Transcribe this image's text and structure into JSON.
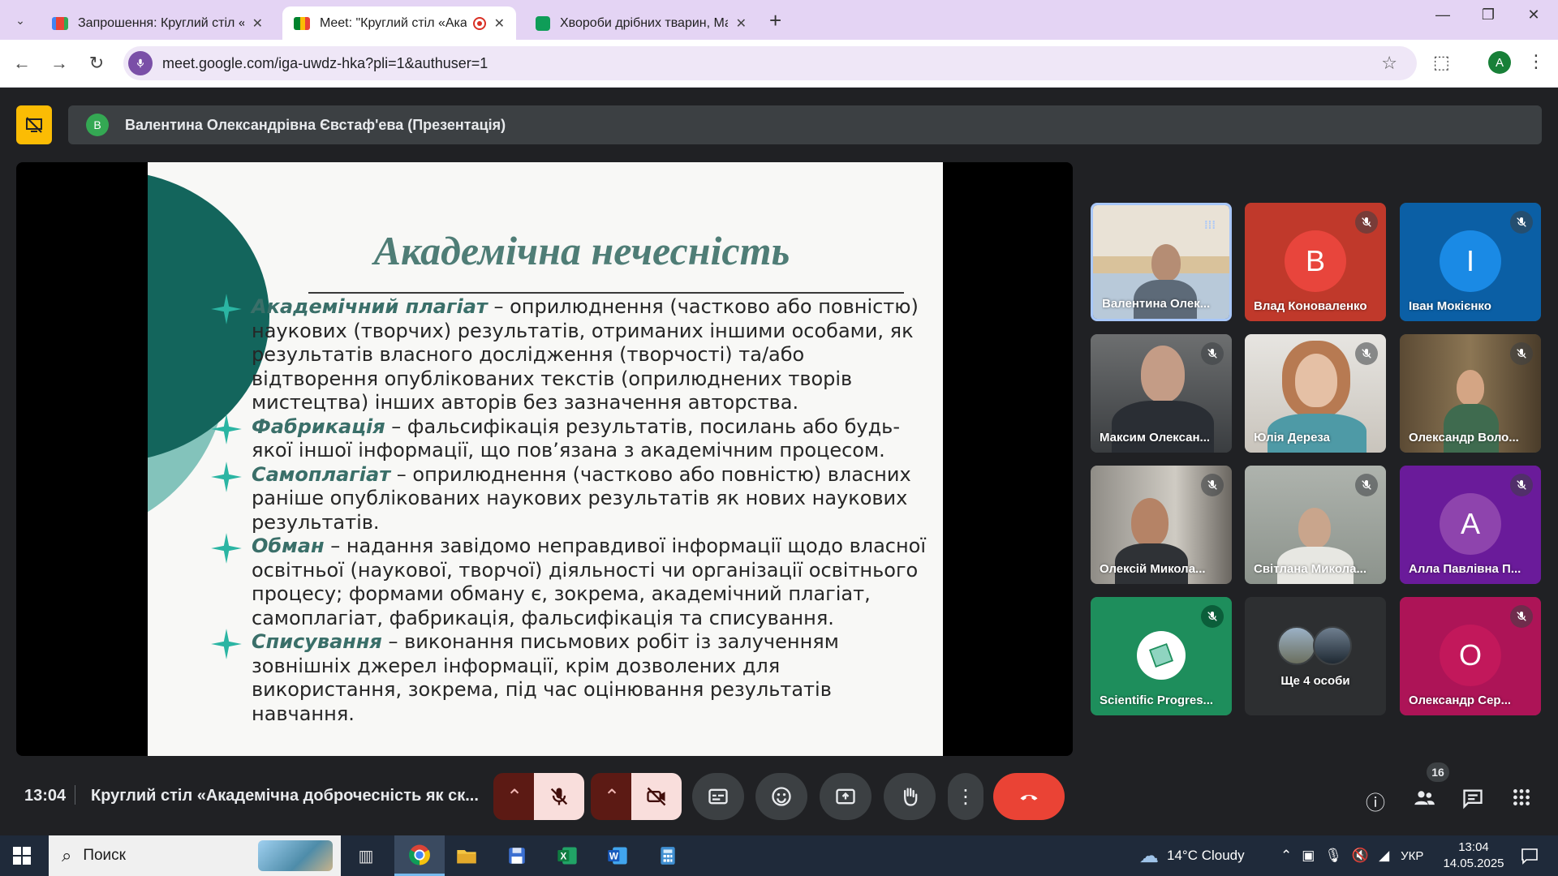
{
  "browser": {
    "tabs": [
      {
        "title": "Запрошення: Круглий стіл «Академічна доброчесність",
        "favicon": "gmail-icon",
        "active": false
      },
      {
        "title": "Meet: \"Круглий стіл «Академічна доброчесність",
        "favicon": "meet-icon",
        "active": true
      },
      {
        "title": "Хвороби дрібних тварин, Магістри",
        "favicon": "sheets-icon",
        "active": false
      }
    ],
    "url": "meet.google.com/iga-uwdz-hka?pli=1&authuser=1",
    "profile_initial": "A"
  },
  "presenter": {
    "initial": "В",
    "label": "Валентина Олександрівна Євстаф'ева (Презентація)"
  },
  "slide": {
    "title": "Академічна нечесність",
    "bullets": [
      {
        "term": "Академічний плагіат",
        "text": " – оприлюднення (частково або повністю) наукових (творчих) результатів, отриманих іншими особами, як результатів власного дослідження (творчості) та/або відтворення опублікованих текстів (оприлюднених творів мистецтва) інших авторів без зазначення авторства."
      },
      {
        "term": "Фабрикація",
        "text": " – фальсифікація результатів, посилань або будь-якої іншої інформації, що пов’язана з академічним процесом."
      },
      {
        "term": "Самоплагіат",
        "text": " – оприлюднення (частково або повністю) власних раніше опублікованих наукових результатів як нових наукових результатів."
      },
      {
        "term": "Обман",
        "text": " – надання завідомо неправдивої інформації щодо власної освітньої (наукової, творчої) діяльності чи організації освітнього процесу; формами обману є, зокрема, академічний плагіат, самоплагіат, фабрикація, фальсифікація та списування."
      },
      {
        "term": "Списування",
        "text": " – виконання письмових робіт із залученням зовнішніх джерел інформації, крім дозволених для використання, зокрема, під час оцінювання результатів навчання."
      }
    ]
  },
  "participants": [
    {
      "name": "Валентина Олек...",
      "type": "video",
      "speaking": true
    },
    {
      "name": "Влад Коноваленко",
      "type": "avatar",
      "initial": "В",
      "color": "#e8453c"
    },
    {
      "name": "Іван Мокієнко",
      "type": "avatar",
      "initial": "І",
      "color": "#1a8ae5"
    },
    {
      "name": "Максим Олексан...",
      "type": "video"
    },
    {
      "name": "Юлія Дереза",
      "type": "video"
    },
    {
      "name": "Олександр Воло...",
      "type": "video"
    },
    {
      "name": "Олексій Микола...",
      "type": "video"
    },
    {
      "name": "Світлана Микола...",
      "type": "video"
    },
    {
      "name": "Алла Павлівна П...",
      "type": "avatar",
      "initial": "А",
      "color": "#8e44ad"
    },
    {
      "name": "Scientific Progres...",
      "type": "logo"
    },
    {
      "name": "Ще 4 особи",
      "type": "more"
    },
    {
      "name": "Олександр Сер...",
      "type": "avatar",
      "initial": "О",
      "color": "#c2185b"
    }
  ],
  "controls": {
    "time": "13:04",
    "meeting_title": "Круглий стіл «Академічна доброчесність як ск...",
    "participants_count": "16"
  },
  "taskbar": {
    "search_placeholder": "Поиск",
    "weather": "14°C  Cloudy",
    "language": "УКР",
    "time": "13:04",
    "date": "14.05.2025"
  }
}
